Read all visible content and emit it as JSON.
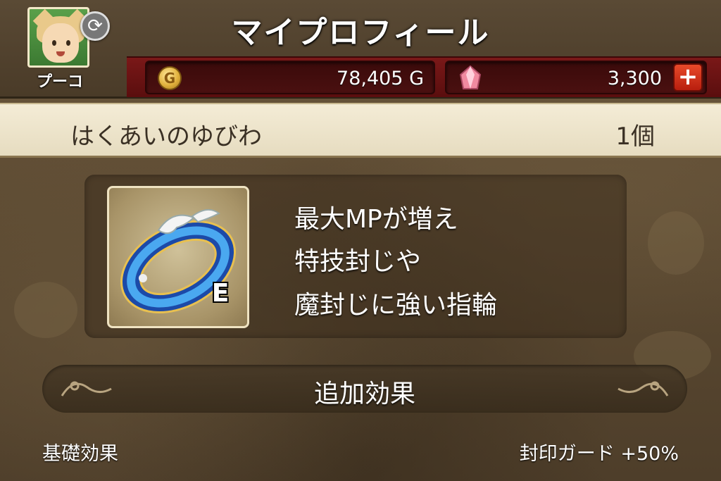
{
  "header": {
    "title": "マイプロフィール",
    "character_name": "プーコ",
    "gold": "78,405 G",
    "gems": "3,300",
    "gold_icon": "coin-icon",
    "gem_icon": "gem-icon",
    "add_gems_icon": "plus-icon",
    "add_gems_label": "+"
  },
  "item": {
    "name": "はくあいのゆびわ",
    "count": "1個",
    "equipped_badge": "E",
    "description_lines": [
      "最大MPが増え",
      "特技封じや",
      "魔封じに強い指輪"
    ]
  },
  "effects": {
    "section_title": "追加効果",
    "base_label": "基礎効果",
    "base_value": "封印ガード +50%"
  },
  "colors": {
    "header_bar": "#7a1818",
    "item_row": "#f4ecd6",
    "plus_button": "#e84a2a"
  }
}
